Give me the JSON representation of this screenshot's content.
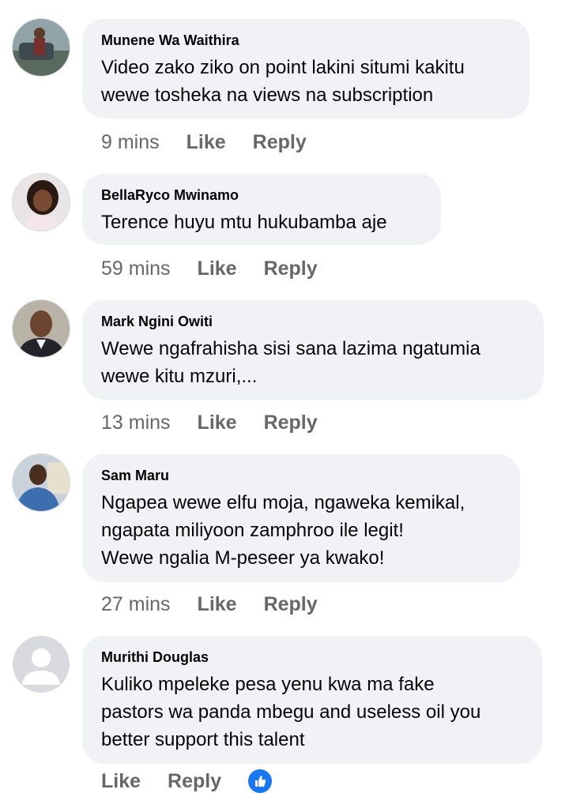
{
  "comments": [
    {
      "author": "Munene Wa Waithira",
      "text": "Video zako ziko on point lakini situmi kakitu\nwewe tosheka na views na subscription",
      "time": "9 mins",
      "like": "Like",
      "reply": "Reply"
    },
    {
      "author": "BellaRyco Mwinamo",
      "text": "Terence huyu mtu hukubamba aje",
      "time": "59 mins",
      "like": "Like",
      "reply": "Reply"
    },
    {
      "author": "Mark Ngini Owiti",
      "text": "Wewe ngafrahisha sisi sana lazima ngatumia\nwewe kitu mzuri,...",
      "time": "13 mins",
      "like": "Like",
      "reply": "Reply"
    },
    {
      "author": "Sam Maru",
      "text": "Ngapea wewe elfu moja, ngaweka kemikal,\nngapata miliyoon zamphroo ile legit!\nWewe ngalia M-peseer ya kwako!",
      "time": "27 mins",
      "like": "Like",
      "reply": "Reply"
    },
    {
      "author": "Murithi Douglas",
      "text": "Kuliko mpeleke pesa yenu kwa ma fake\npastors wa panda mbegu and useless oil you\nbetter  support this talent",
      "time": "",
      "like": "Like",
      "reply": "Reply"
    }
  ],
  "colors": {
    "bubble": "#f0f2f5",
    "meta": "#65676b",
    "accent": "#1877f2"
  },
  "icons": {
    "reaction": "like-thumb-icon",
    "default_avatar": "default-profile-icon"
  }
}
